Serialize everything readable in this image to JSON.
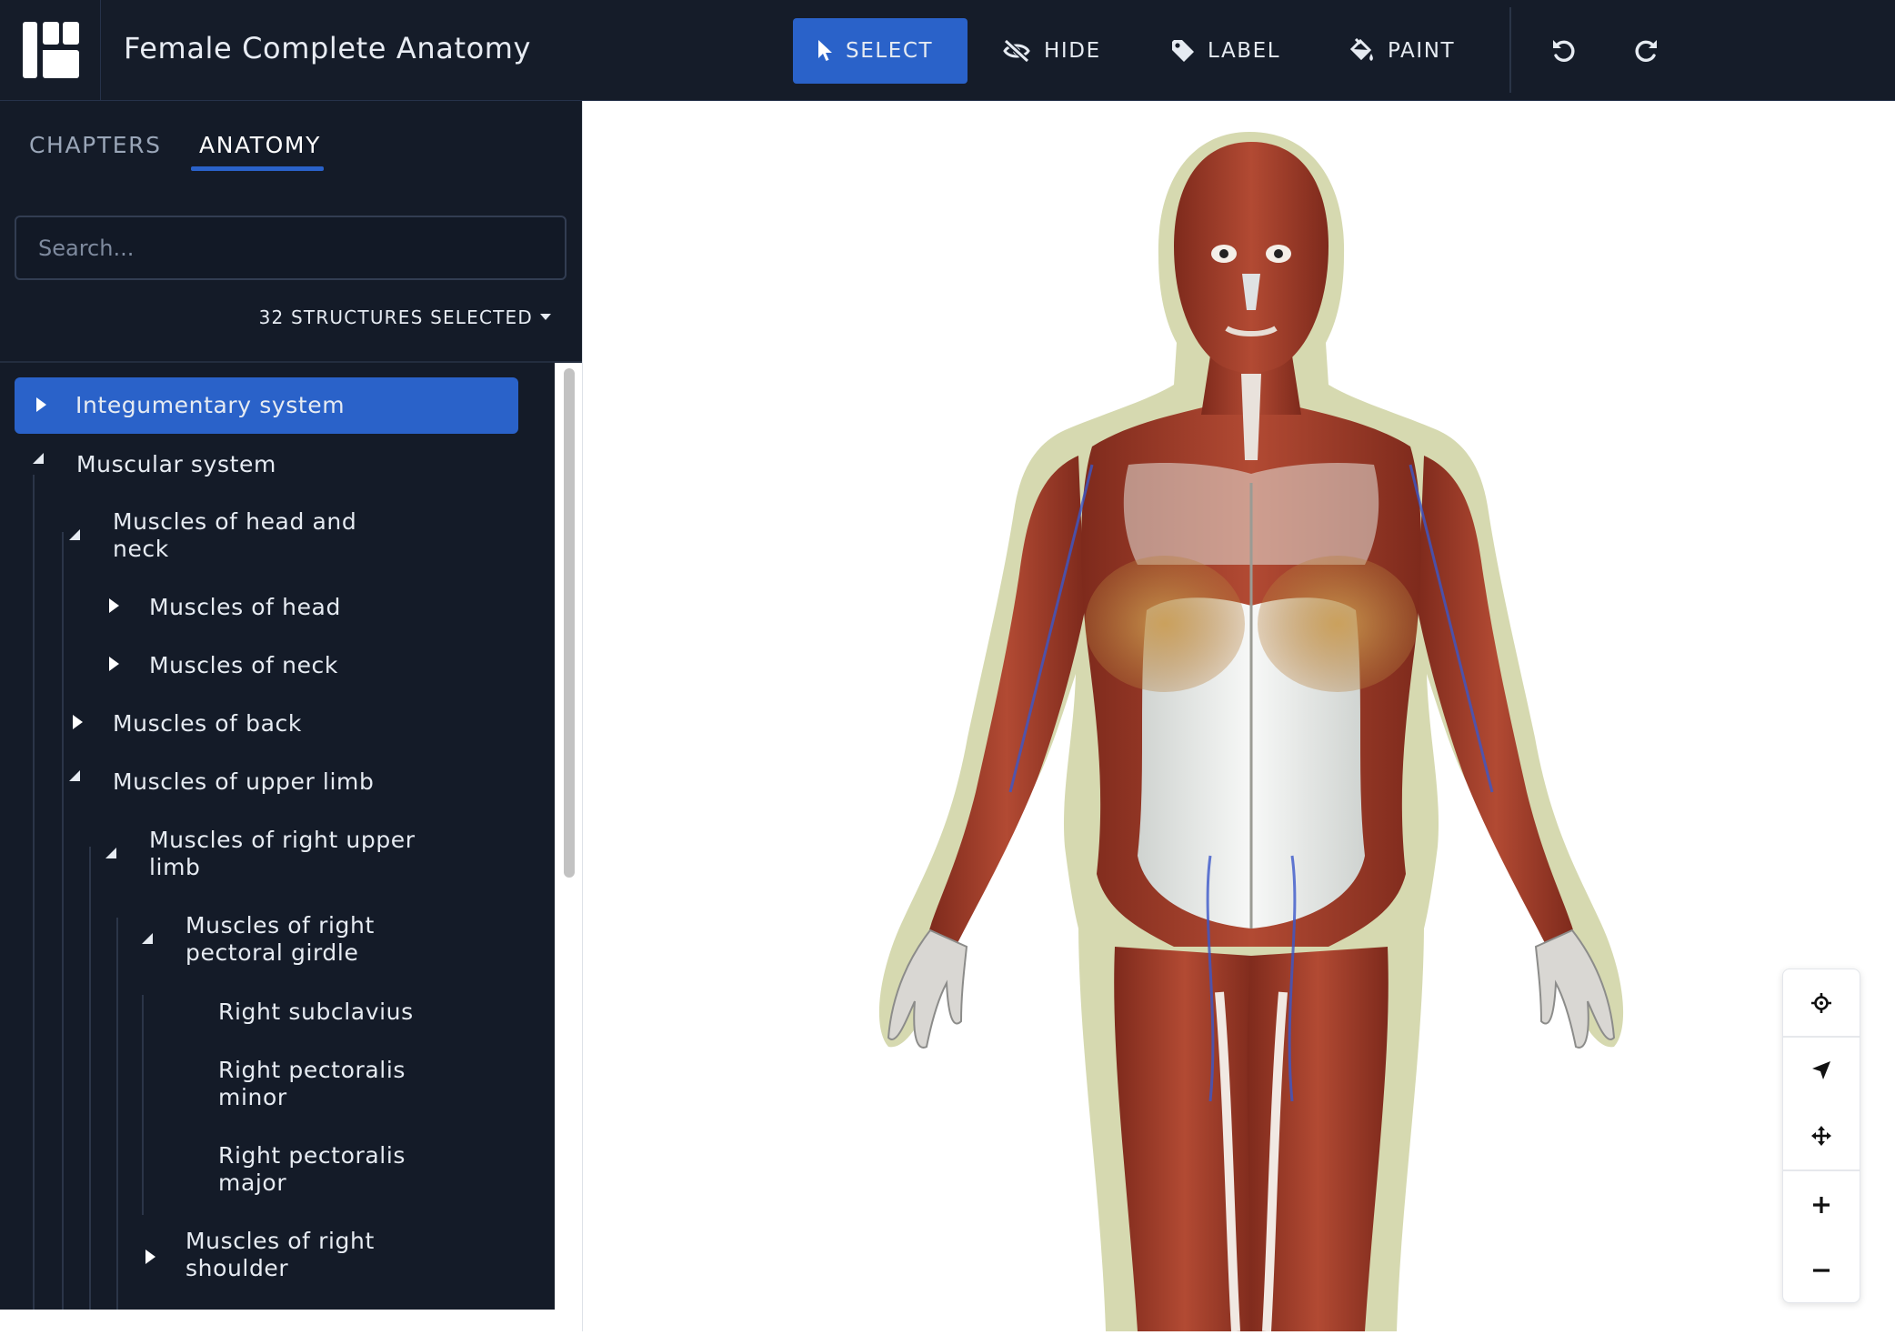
{
  "app": {
    "title": "Female Complete Anatomy"
  },
  "toolbar": {
    "select_label": "SELECT",
    "hide_label": "HIDE",
    "label_label": "LABEL",
    "paint_label": "PAINT"
  },
  "sidebar": {
    "tabs": [
      {
        "label": "CHAPTERS"
      },
      {
        "label": "ANATOMY"
      }
    ],
    "search": {
      "placeholder": "Search...",
      "value": ""
    },
    "selection_summary": "32 STRUCTURES SELECTED",
    "tree": [
      {
        "label": "Integumentary system"
      },
      {
        "label": "Muscular system"
      },
      {
        "label": "Muscles of head and\nneck"
      },
      {
        "label": "Muscles of head"
      },
      {
        "label": "Muscles of neck"
      },
      {
        "label": "Muscles of back"
      },
      {
        "label": "Muscles of upper limb"
      },
      {
        "label": "Muscles of right upper\nlimb"
      },
      {
        "label": "Muscles of right\npectoral girdle"
      },
      {
        "label": "Right subclavius"
      },
      {
        "label": "Right pectoralis\nminor"
      },
      {
        "label": "Right pectoralis\nmajor"
      },
      {
        "label": "Muscles of right\nshoulder"
      }
    ]
  },
  "colors": {
    "toolbar_bg": "#151c29",
    "sidebar_bg": "#141b28",
    "accent": "#2a62c9",
    "muscle": "#a8402c",
    "fascia": "#e9ecea"
  },
  "viewport": {
    "controls": [
      "target-icon",
      "navigate-icon",
      "move-icon",
      "zoom-in-icon",
      "zoom-out-icon"
    ]
  }
}
